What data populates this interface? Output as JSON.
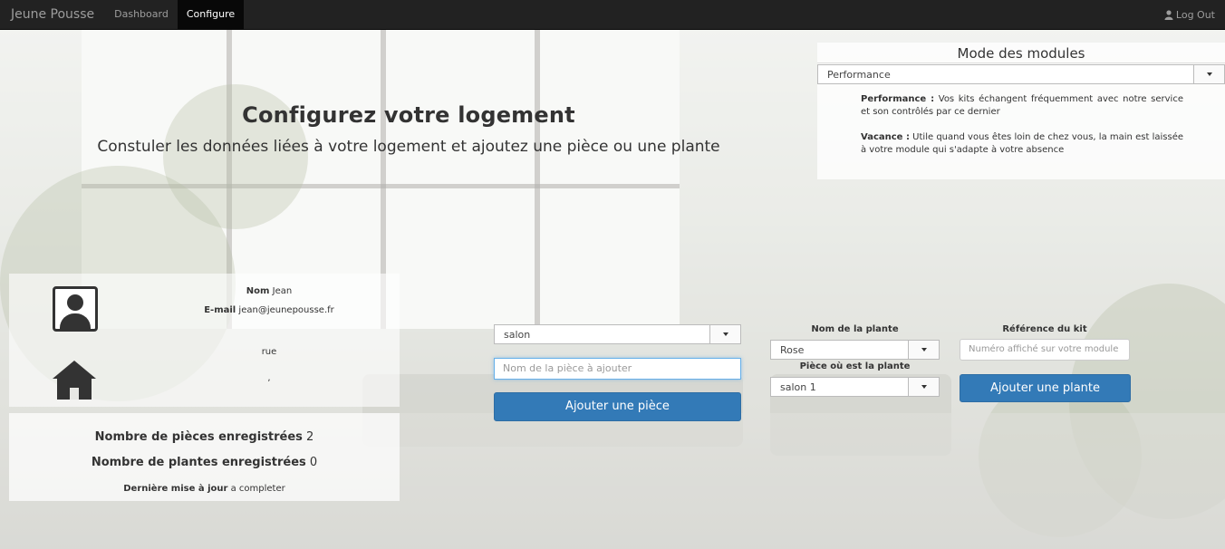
{
  "navbar": {
    "brand": "Jeune Pousse",
    "links": [
      {
        "label": "Dashboard",
        "active": false
      },
      {
        "label": "Configure",
        "active": true
      }
    ],
    "logout_label": "Log Out"
  },
  "header": {
    "title": "Configurez votre logement",
    "subtitle": "Constuler les données liées à votre logement et ajoutez une pièce ou une plante"
  },
  "mode_panel": {
    "title": "Mode des modules",
    "selected": "Performance",
    "descriptions": [
      {
        "name": "Performance :",
        "text": "Vos kits échangent fréquemment avec notre service et son contrôlés par ce dernier"
      },
      {
        "name": "Vacance :",
        "text": "Utile quand vous êtes loin de chez vous, la main est laissée à votre module qui s'adapte à votre absence"
      }
    ]
  },
  "profile": {
    "name_label": "Nom",
    "name_value": "Jean",
    "email_label": "E-mail",
    "email_value": "jean@jeunepousse.fr",
    "address_street": "rue",
    "address_city": ","
  },
  "stats": {
    "rooms_label": "Nombre de pièces enregistrées",
    "rooms_value": "2",
    "plants_label": "Nombre de plantes enregistrées",
    "plants_value": "0",
    "updated_label": "Dernière mise à jour",
    "updated_value": "a completer"
  },
  "room_form": {
    "selected_room": "salon",
    "new_room_placeholder": "Nom de la pièce à ajouter",
    "add_room_label": "Ajouter une pièce"
  },
  "plant_form": {
    "plant_name_label": "Nom de la plante",
    "plant_selected": "Rose",
    "room_label": "Pièce où est la plante",
    "room_selected": "salon 1",
    "kit_label": "Référence du kit",
    "kit_placeholder": "Numéro affiché sur votre module",
    "add_plant_label": "Ajouter une plante"
  },
  "colors": {
    "navbar_bg": "#222222",
    "primary": "#337ab7",
    "text": "#333333"
  }
}
